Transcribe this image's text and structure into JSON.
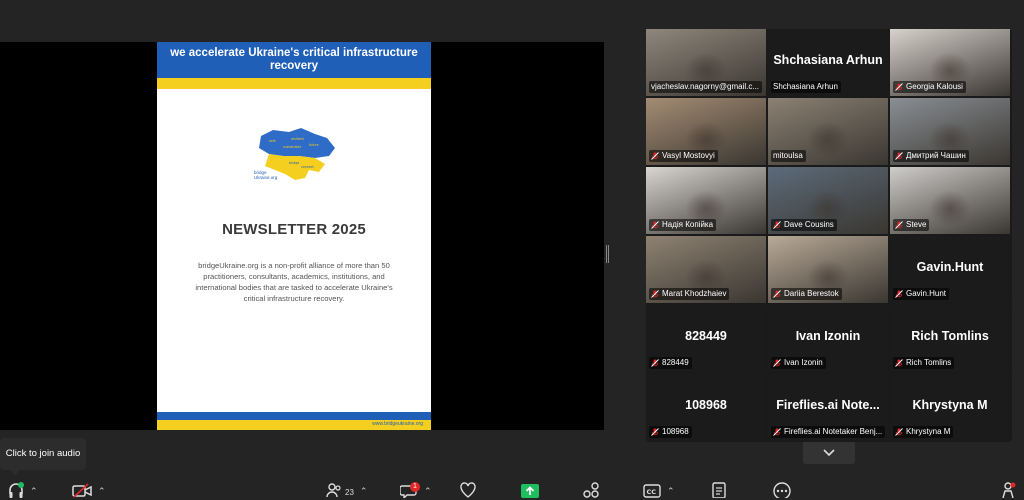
{
  "slide": {
    "banner": "we accelerate Ukraine's critical infrastructure recovery",
    "brand": "bridge Ukraine.org",
    "title": "NEWSLETTER 2025",
    "description": "bridgeUkraine.org is a non-profit alliance of more than 50 practitioners, consultants, academics, institutions, and international bodies that are tasked to accelerate Ukraine's critical infrastructure recovery.",
    "footer_url": "www.bridgeukraine.org"
  },
  "participants": [
    {
      "name": "vjacheslav.nagorny@gmail.c...",
      "big": "",
      "muted": false,
      "video": true,
      "bg": "#8f877c"
    },
    {
      "name": "Shchasiana Arhun",
      "big": "Shchasiana Arhun",
      "muted": false,
      "video": false
    },
    {
      "name": "Georgia Kalousi",
      "big": "",
      "muted": true,
      "video": true,
      "bg": "#d8d2cc"
    },
    {
      "name": "Vasyl Mostovyi",
      "big": "",
      "muted": true,
      "video": true,
      "bg": "#a48c73"
    },
    {
      "name": "mitoulsa",
      "big": "",
      "muted": false,
      "video": true,
      "bg": "#8b8173",
      "active": true
    },
    {
      "name": "Дмитрий Чашин",
      "big": "",
      "muted": true,
      "video": true,
      "bg": "#8a8f94"
    },
    {
      "name": "Надія Копійка",
      "big": "",
      "muted": true,
      "video": true,
      "bg": "#d9d6d2"
    },
    {
      "name": "Dave Cousins",
      "big": "",
      "muted": true,
      "video": true,
      "bg": "#5c6b7a"
    },
    {
      "name": "Steve",
      "big": "",
      "muted": true,
      "video": true,
      "bg": "#cfcdca"
    },
    {
      "name": "Marat Khodzhaiev",
      "big": "",
      "muted": true,
      "video": true,
      "bg": "#8e8272"
    },
    {
      "name": "Dariia Berestok",
      "big": "",
      "muted": true,
      "video": true,
      "bg": "#b9aa98"
    },
    {
      "name": "Gavin.Hunt",
      "big": "Gavin.Hunt",
      "muted": true,
      "video": false
    },
    {
      "name": "828449",
      "big": "828449",
      "muted": true,
      "video": false
    },
    {
      "name": "Ivan Izonin",
      "big": "Ivan Izonin",
      "muted": true,
      "video": false
    },
    {
      "name": "Rich Tomlins",
      "big": "Rich Tomlins",
      "muted": true,
      "video": false
    },
    {
      "name": "108968",
      "big": "108968",
      "muted": true,
      "video": false
    },
    {
      "name": "Fireflies.ai Notetaker Benj...",
      "big": "Fireflies.ai  Note...",
      "muted": true,
      "video": false
    },
    {
      "name": "Khrystyna M",
      "big": "Khrystyna M",
      "muted": true,
      "video": false
    }
  ],
  "tooltip": "Click to join audio",
  "toolbar": {
    "participants_count": "23",
    "chat_badge": "1"
  },
  "colors": {
    "active_speaker": "#2ecc71",
    "share_green": "#1fbf5f",
    "muted_red": "#e02828"
  }
}
